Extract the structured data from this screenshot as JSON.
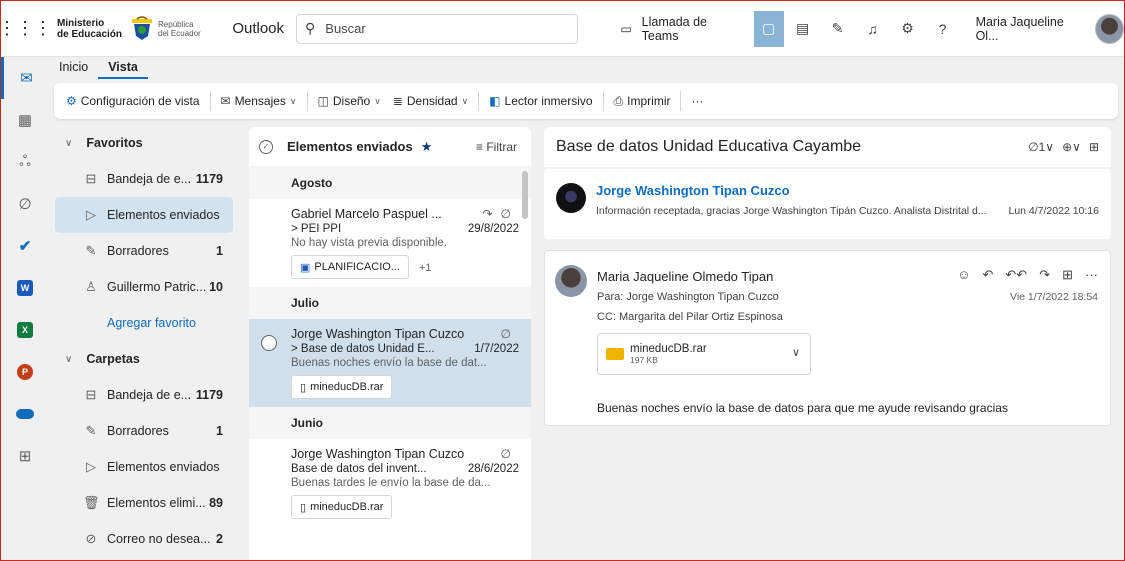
{
  "topbar": {
    "ministerio_line1": "Ministerio",
    "ministerio_line2": "de Educación",
    "republica_line1": "República",
    "republica_line2": "del Ecuador",
    "app_name": "Outlook",
    "search_placeholder": "Buscar",
    "teams_call": "Llamada de Teams",
    "user_name": "Maria Jaqueline Ol...",
    "icons": [
      "waffle-icon",
      "search-icon",
      "video-icon",
      "chat-icon",
      "word-icon",
      "note-icon",
      "bell-icon",
      "gear-icon",
      "help-icon"
    ]
  },
  "ribbon": {
    "tabs": [
      "Inicio",
      "Vista"
    ],
    "buttons": [
      "Configuración de vista",
      "Mensajes",
      "Diseño",
      "Densidad",
      "Lector inmersivo",
      "Imprimir",
      "···"
    ]
  },
  "folders": {
    "favoritos": "Favoritos",
    "fav_items": [
      {
        "label": "Bandeja de e...",
        "count": "1179"
      },
      {
        "label": "Elementos enviados",
        "count": ""
      },
      {
        "label": "Borradores",
        "count": "1"
      },
      {
        "label": "Guillermo Patric...",
        "count": "10"
      }
    ],
    "agregar": "Agregar favorito",
    "carpetas": "Carpetas",
    "folder_items": [
      {
        "label": "Bandeja de e...",
        "count": "1179"
      },
      {
        "label": "Borradores",
        "count": "1"
      },
      {
        "label": "Elementos enviados",
        "count": ""
      },
      {
        "label": "Elementos elimi...",
        "count": "89"
      },
      {
        "label": "Correo no desea...",
        "count": "2"
      }
    ]
  },
  "message_list": {
    "title": "Elementos enviados",
    "filter": "Filtrar",
    "groups": {
      "agosto": "Agosto",
      "julio": "Julio",
      "junio": "Junio"
    },
    "messages": [
      {
        "sender": "Gabriel Marcelo Paspuel ...",
        "subject": "> PEI PPI",
        "date": "29/8/2022",
        "preview": "No hay vista previa disponible.",
        "attachment": "PLANIFICACIO...",
        "extra": "+1"
      },
      {
        "sender": "Jorge Washington Tipan Cuzco",
        "subject": "> Base de datos Unidad E...",
        "date": "1/7/2022",
        "preview": "Buenas noches envío la base de dat...",
        "attachment": "mineducDB.rar"
      },
      {
        "sender": "Jorge Washington Tipan Cuzco",
        "subject": "Base de datos del invent...",
        "date": "28/6/2022",
        "preview": "Buenas tardes le envío la base de da...",
        "attachment": "mineducDB.rar"
      }
    ]
  },
  "reading": {
    "title": "Base de datos Unidad Educativa Cayambe",
    "tools": "1",
    "msg1": {
      "from": "Jorge Washington Tipan Cuzco",
      "preview": "Información receptada, gracias Jorge Washington Tipán Cuzco. Analista Distrital d...",
      "date": "Lun 4/7/2022 10:16"
    },
    "msg2": {
      "from": "Maria Jaqueline Olmedo Tipan",
      "to": "Para: Jorge Washington Tipan Cuzco",
      "cc": "CC: Margarita del Pilar Ortiz Espinosa",
      "date": "Vie 1/7/2022 18:54",
      "file_name": "mineducDB.rar",
      "file_size": "197 KB",
      "body": "Buenas noches envío la base de datos para que me ayude revisando gracias"
    }
  },
  "colors": {
    "accent": "#0f6cbd",
    "selected": "#cfe0ec",
    "frame": "#c42b1c"
  }
}
